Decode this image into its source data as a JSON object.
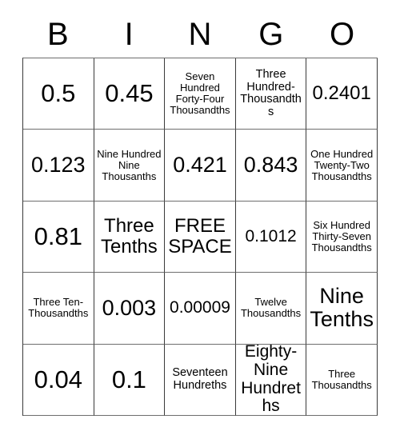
{
  "card": {
    "title_letters": [
      "B",
      "I",
      "N",
      "G",
      "O"
    ],
    "rows": [
      [
        {
          "text": "0.5",
          "size": "sz-xxl"
        },
        {
          "text": "0.45",
          "size": "sz-xxl"
        },
        {
          "text": "Seven Hundred Forty-Four Thousandths",
          "size": "sz-xs"
        },
        {
          "text": "Three Hundred-Thousandths",
          "size": "sz-s"
        },
        {
          "text": "0.2401",
          "size": "sz-l"
        }
      ],
      [
        {
          "text": "0.123",
          "size": "sz-xl"
        },
        {
          "text": "Nine Hundred Nine Thousanths",
          "size": "sz-xs"
        },
        {
          "text": "0.421",
          "size": "sz-xl"
        },
        {
          "text": "0.843",
          "size": "sz-xl"
        },
        {
          "text": "One Hundred Twenty-Two Thousandths",
          "size": "sz-xs"
        }
      ],
      [
        {
          "text": "0.81",
          "size": "sz-xxl"
        },
        {
          "text": "Three Tenths",
          "size": "sz-l"
        },
        {
          "text": "FREE SPACE",
          "size": "sz-l"
        },
        {
          "text": "0.1012",
          "size": "sz-m"
        },
        {
          "text": "Six Hundred Thirty-Seven Thousandths",
          "size": "sz-xs"
        }
      ],
      [
        {
          "text": "Three Ten-Thousandths",
          "size": "sz-xs"
        },
        {
          "text": "0.003",
          "size": "sz-xl"
        },
        {
          "text": "0.00009",
          "size": "sz-m"
        },
        {
          "text": "Twelve Thousandths",
          "size": "sz-xs"
        },
        {
          "text": "Nine Tenths",
          "size": "sz-xl"
        }
      ],
      [
        {
          "text": "0.04",
          "size": "sz-xxl"
        },
        {
          "text": "0.1",
          "size": "sz-xxl"
        },
        {
          "text": "Seventeen Hundreths",
          "size": "sz-s"
        },
        {
          "text": "Eighty-Nine Hundreths",
          "size": "sz-m"
        },
        {
          "text": "Three Thousandths",
          "size": "sz-xs"
        }
      ]
    ]
  },
  "colors": {
    "background": "#ffffff",
    "text": "#000000",
    "border_vertical": "#3a3a3a",
    "border_horizontal": "#6e6e6e"
  }
}
